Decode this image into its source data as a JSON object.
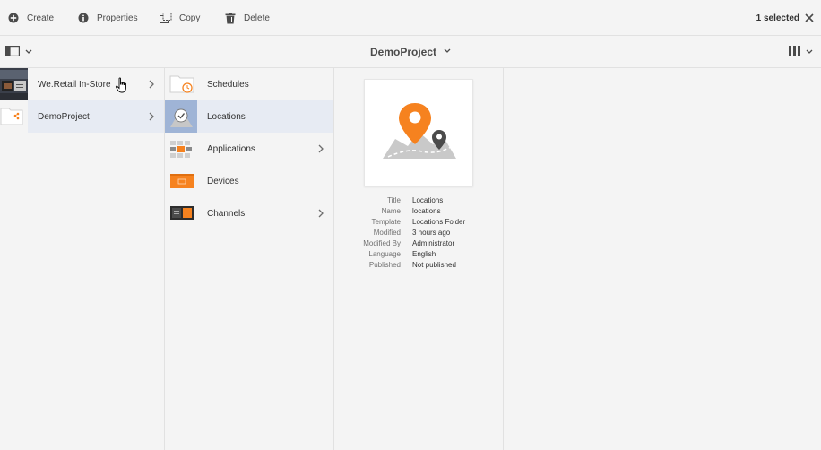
{
  "toolbar": {
    "create_label": "Create",
    "properties_label": "Properties",
    "copy_label": "Copy",
    "delete_label": "Delete",
    "selection_count": "1 selected"
  },
  "header": {
    "title": "DemoProject"
  },
  "column1": {
    "items": [
      {
        "label": "We.Retail In-Store",
        "icon": "store-thumbnail",
        "has_children": true
      },
      {
        "label": "DemoProject",
        "icon": "folder-share-icon",
        "has_children": true,
        "selected": true
      }
    ]
  },
  "column2": {
    "items": [
      {
        "label": "Schedules",
        "icon": "schedule-folder-icon",
        "has_children": false
      },
      {
        "label": "Locations",
        "icon": "locations-folder-icon",
        "has_children": false,
        "selected": true
      },
      {
        "label": "Applications",
        "icon": "applications-folder-icon",
        "has_children": true
      },
      {
        "label": "Devices",
        "icon": "devices-folder-icon",
        "has_children": false
      },
      {
        "label": "Channels",
        "icon": "channels-folder-icon",
        "has_children": true
      }
    ]
  },
  "details": {
    "preview_icon": "map-pin-icon",
    "rows": [
      {
        "key": "Title",
        "value": "Locations"
      },
      {
        "key": "Name",
        "value": "locations"
      },
      {
        "key": "Template",
        "value": "Locations Folder"
      },
      {
        "key": "Modified",
        "value": "3 hours ago"
      },
      {
        "key": "Modified By",
        "value": "Administrator"
      },
      {
        "key": "Language",
        "value": "English"
      },
      {
        "key": "Published",
        "value": "Not published"
      }
    ]
  },
  "colors": {
    "accent_orange": "#f6821f",
    "selected_row": "#e7ebf3",
    "text": "#323232"
  }
}
